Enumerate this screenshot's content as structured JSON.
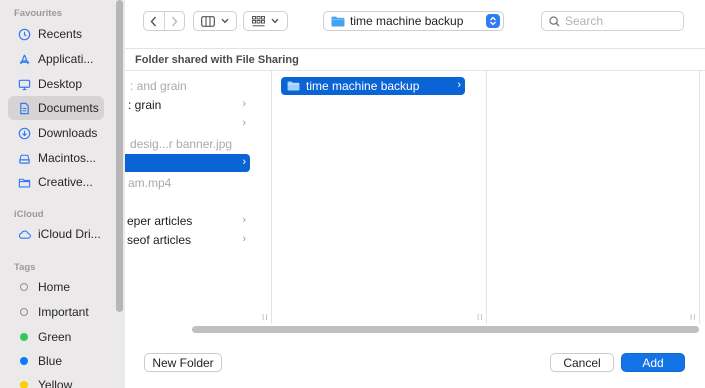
{
  "sidebar": {
    "favourites_label": "Favourites",
    "favourites": [
      {
        "label": "Recents",
        "icon": "clock-icon"
      },
      {
        "label": "Applicati...",
        "icon": "applications-icon"
      },
      {
        "label": "Desktop",
        "icon": "desktop-icon"
      },
      {
        "label": "Documents",
        "icon": "document-icon",
        "selected": true
      },
      {
        "label": "Downloads",
        "icon": "download-icon"
      },
      {
        "label": "Macintos...",
        "icon": "drive-icon"
      },
      {
        "label": "Creative...",
        "icon": "folder-icon"
      }
    ],
    "icloud_label": "iCloud",
    "icloud": [
      {
        "label": "iCloud Dri...",
        "icon": "cloud-icon"
      }
    ],
    "tags_label": "Tags",
    "tags": [
      {
        "label": "Home",
        "color": "none"
      },
      {
        "label": "Important",
        "color": "none"
      },
      {
        "label": "Green",
        "color": "#34c759"
      },
      {
        "label": "Blue",
        "color": "#0a7aff"
      },
      {
        "label": "Yellow",
        "color": "#ffcc00"
      }
    ]
  },
  "toolbar": {
    "path_popup": "time machine backup",
    "search_placeholder": "Search"
  },
  "location_title": "Folder shared with File Sharing",
  "columns": {
    "col1": [
      {
        "label": ": and grain",
        "dim": true,
        "chevron": false
      },
      {
        "label": ": grain",
        "dim": false,
        "chevron": true
      },
      {
        "label": "",
        "dim": false,
        "chevron": true
      },
      {
        "label": "desig...r banner.jpg",
        "dim": true,
        "chevron": false
      },
      {
        "label": "",
        "selected": true,
        "chevron": true
      },
      {
        "label": "am.mp4",
        "dim": true,
        "chevron": false
      },
      {
        "label": "",
        "dim": false,
        "chevron": false
      },
      {
        "label": "eper articles",
        "dim": false,
        "chevron": true
      },
      {
        "label": "seof articles",
        "dim": false,
        "chevron": true
      }
    ],
    "col2": [
      {
        "label": "time machine backup",
        "selected": true,
        "chevron": true
      }
    ]
  },
  "buttons": {
    "new_folder": "New Folder",
    "cancel": "Cancel",
    "add": "Add"
  }
}
